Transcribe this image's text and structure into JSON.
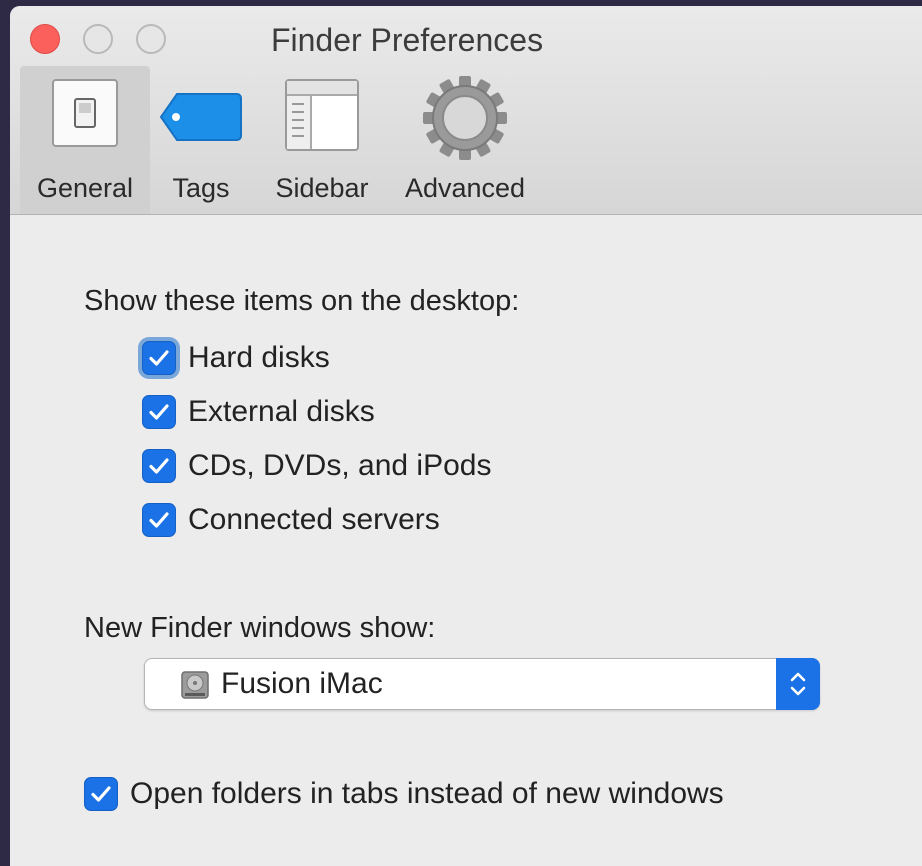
{
  "window": {
    "title": "Finder Preferences"
  },
  "toolbar": {
    "tabs": [
      {
        "label": "General",
        "icon": "general-switch-icon",
        "selected": true
      },
      {
        "label": "Tags",
        "icon": "tag-icon"
      },
      {
        "label": "Sidebar",
        "icon": "sidebar-icon"
      },
      {
        "label": "Advanced",
        "icon": "gear-icon"
      }
    ]
  },
  "general": {
    "desktop_heading": "Show these items on the desktop:",
    "desktop_items": [
      {
        "label": "Hard disks",
        "checked": true
      },
      {
        "label": "External disks",
        "checked": true
      },
      {
        "label": "CDs, DVDs, and iPods",
        "checked": true
      },
      {
        "label": "Connected servers",
        "checked": true
      }
    ],
    "new_window_heading": "New Finder windows show:",
    "new_window_select": {
      "value": "Fusion iMac",
      "icon": "hard-disk-icon"
    },
    "open_in_tabs": {
      "label": "Open folders in tabs instead of new windows",
      "checked": true
    }
  },
  "colors": {
    "accent": "#1a72e6",
    "close": "#fc605c",
    "background": "#ececec"
  }
}
